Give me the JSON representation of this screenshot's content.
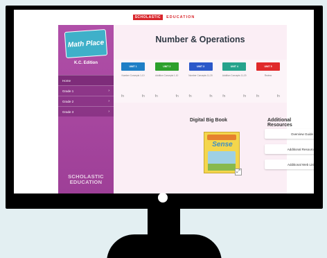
{
  "header": {
    "brand": "SCHOLASTIC",
    "section": "EDUCATION"
  },
  "sidebar": {
    "logo": "Math Place",
    "edition": "K.C. Edition",
    "nav": [
      {
        "label": "Home",
        "chevron": ""
      },
      {
        "label": "Grade 1",
        "chevron": "›"
      },
      {
        "label": "Grade 2",
        "chevron": "›"
      },
      {
        "label": "Grade 3",
        "chevron": "›"
      }
    ],
    "footer": [
      "SCHOLASTIC",
      "EDUCATION"
    ]
  },
  "main": {
    "title": "Number & Operations",
    "units": [
      {
        "label": "UNIT 1",
        "color": "#1e7fc6",
        "title": "Number Concepts 1-10",
        "icons": [
          "fn",
          "fn"
        ]
      },
      {
        "label": "UNIT 2",
        "color": "#2ca02c",
        "title": "Addition Concepts 1-10",
        "icons": [
          "fn",
          "fn"
        ]
      },
      {
        "label": "UNIT 3",
        "color": "#2a58c9",
        "title": "Number Concepts 11-20",
        "icons": [
          "fn",
          "fn"
        ]
      },
      {
        "label": "UNIT 4",
        "color": "#25a38c",
        "title": "Addition Concepts 11-20",
        "icons": [
          "fn",
          "fn"
        ]
      },
      {
        "label": "UNIT 5",
        "color": "#e02a2a",
        "title": "Review",
        "icons": [
          "fn",
          "fn"
        ]
      }
    ],
    "digital_big_book": {
      "heading": "Digital Big Book",
      "cover_title": "Sense",
      "expand_icon": "expand-icon"
    },
    "additional_resources": {
      "heading": "Additional Resources",
      "items": [
        "Overview Guide",
        "Additional Resources",
        "Additional Web Links"
      ]
    }
  },
  "colors": {
    "sidebar": "#a84aa1",
    "main_bg": "#fbeef5",
    "brand_red": "#d8252b",
    "backdrop": "#e3eff2"
  }
}
